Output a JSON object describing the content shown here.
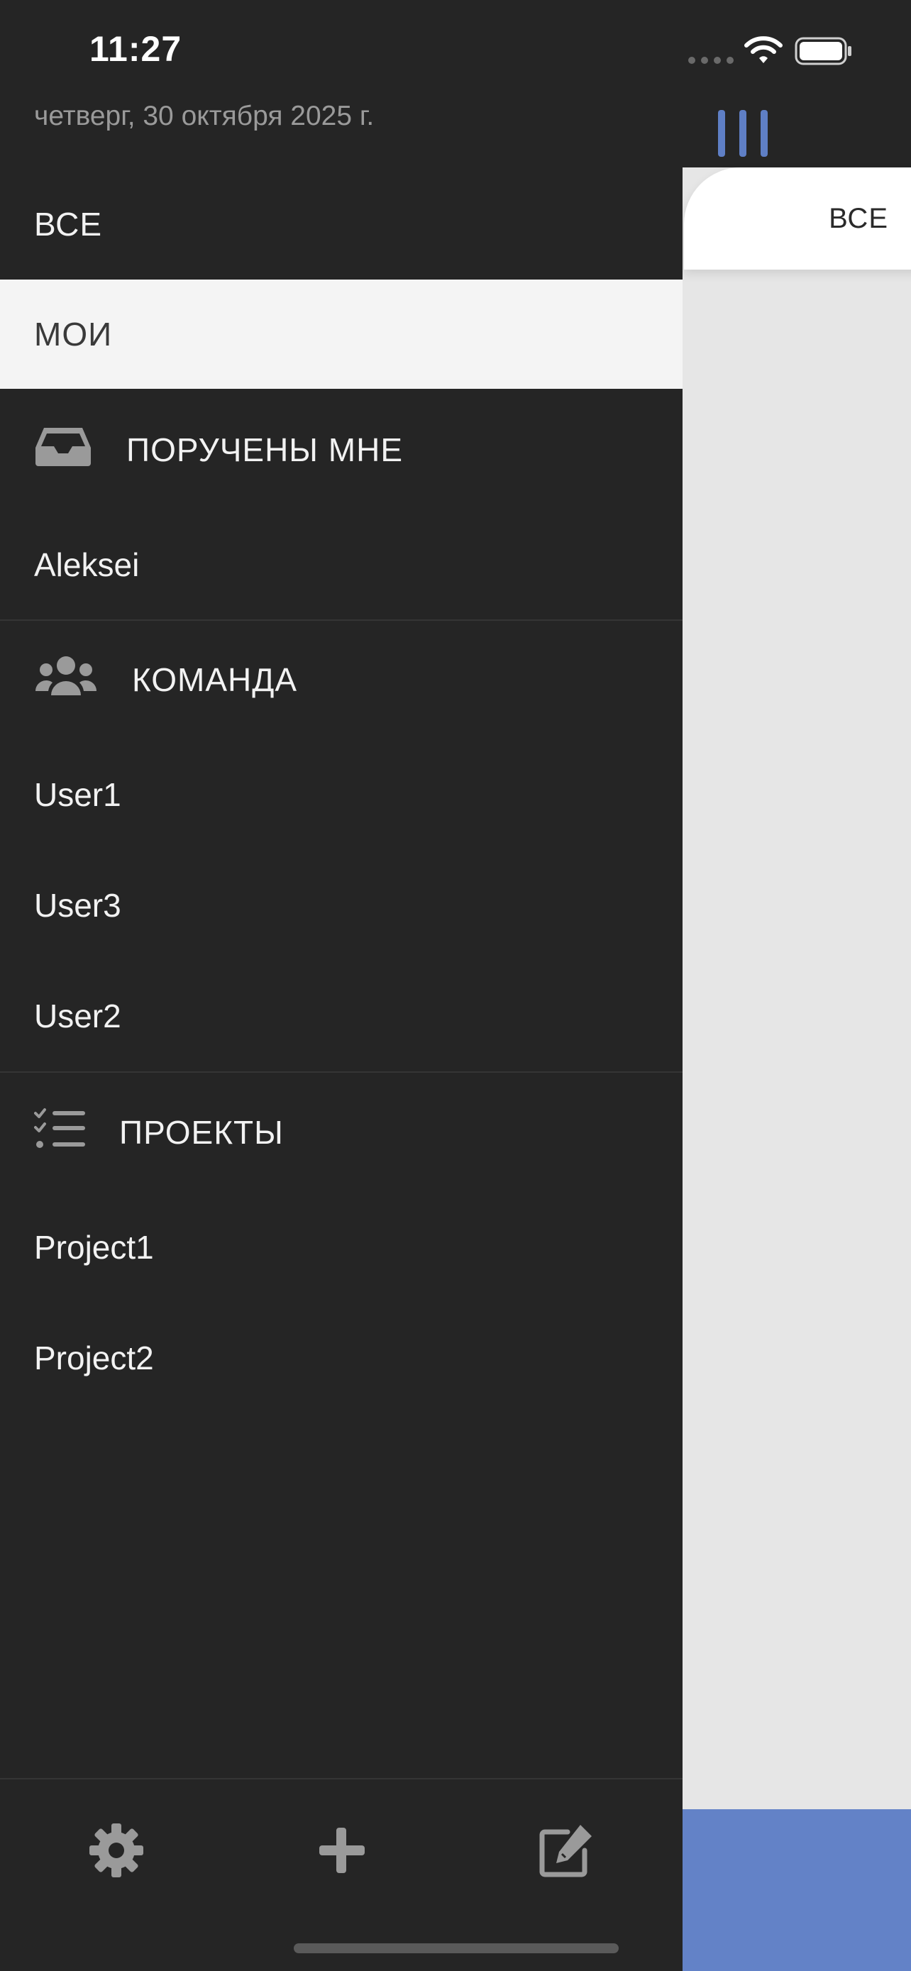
{
  "status_bar": {
    "time": "11:27"
  },
  "drawer": {
    "date": "четверг, 30 октября 2025 г.",
    "top_items": [
      {
        "label": "ВСЕ",
        "selected": false
      },
      {
        "label": "МОИ",
        "selected": true
      }
    ],
    "assigned": {
      "title": "ПОРУЧЕНЫ МНЕ",
      "icon": "inbox-icon",
      "items": [
        "Aleksei"
      ]
    },
    "team": {
      "title": "КОМАНДА",
      "icon": "users-icon",
      "items": [
        "User1",
        "User3",
        "User2"
      ]
    },
    "projects": {
      "title": "ПРОЕКТЫ",
      "icon": "checklist-icon",
      "items": [
        "Project1",
        "Project2"
      ]
    },
    "footer": {
      "buttons": [
        "gear-icon",
        "plus-icon",
        "edit-icon"
      ]
    }
  },
  "content": {
    "tab_label": "ВСЕ",
    "accent_color": "#6382c7",
    "filter_icon": "columns-icon"
  },
  "colors": {
    "drawer_bg": "#252525",
    "selected_row_bg": "#f4f4f4",
    "content_bg": "#e6e6e6",
    "accent": "#6382c7"
  }
}
